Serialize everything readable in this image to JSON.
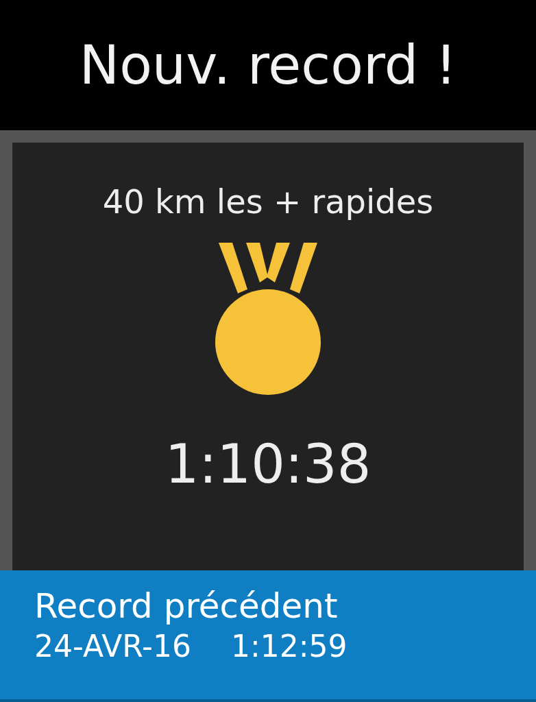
{
  "title": "Nouv. record !",
  "record": {
    "label": "40 km les + rapides",
    "time": "1:10:38"
  },
  "previous": {
    "label": "Record précédent",
    "date": "24-AVR-16",
    "time": "1:12:59"
  }
}
